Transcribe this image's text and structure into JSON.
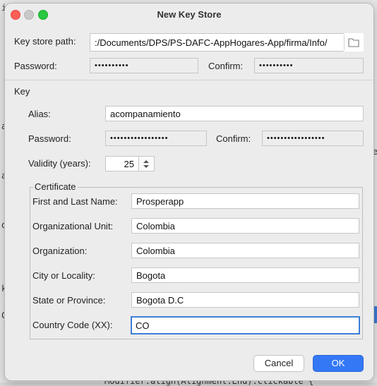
{
  "dialog": {
    "title": "New Key Store",
    "keystore_path_label": "Key store path:",
    "keystore_path_value": ":/Documents/DPS/PS-DAFC-AppHogares-App/firma/Info/",
    "password_label": "Password:",
    "password_value": "••••••••••",
    "confirm_label": "Confirm:",
    "confirm_value": "••••••••••"
  },
  "key": {
    "section_label": "Key",
    "alias_label": "Alias:",
    "alias_value": "acompanamiento",
    "password_label": "Password:",
    "password_value": "•••••••••••••••••",
    "confirm_label": "Confirm:",
    "confirm_value": "•••••••••••••••••",
    "validity_label": "Validity (years):",
    "validity_value": "25"
  },
  "certificate": {
    "section_label": "Certificate",
    "fields": [
      {
        "label": "First and Last Name:",
        "value": "Prosperapp"
      },
      {
        "label": "Organizational Unit:",
        "value": "Colombia"
      },
      {
        "label": "Organization:",
        "value": "Colombia"
      },
      {
        "label": "City or Locality:",
        "value": "Bogota"
      },
      {
        "label": "State or Province:",
        "value": "Bogota D.C"
      },
      {
        "label": "Country Code (XX):",
        "value": "CO"
      }
    ]
  },
  "buttons": {
    "cancel": "Cancel",
    "ok": "OK"
  },
  "background": {
    "code_bottom": "Modifier.align(Alignment.End).clickable {"
  },
  "colors": {
    "accent": "#3478f6",
    "close": "#ff5f57",
    "maximize": "#28c840"
  }
}
